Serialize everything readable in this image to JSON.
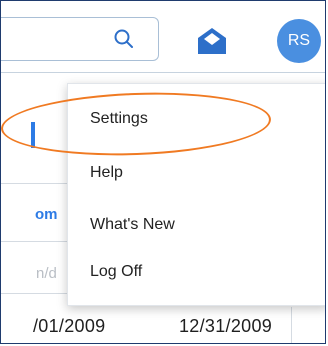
{
  "topbar": {
    "search_icon": "search-icon",
    "mail_icon": "envelope-open-icon",
    "avatar_initials": "RS",
    "accent_color": "#4a8fe0"
  },
  "menu": {
    "items": [
      {
        "label": "Settings"
      },
      {
        "label": "Help"
      },
      {
        "label": "What's New"
      },
      {
        "label": "Log Off"
      }
    ],
    "highlighted_item": "Settings",
    "highlight_color": "#f07a22"
  },
  "background": {
    "partial_text_1": "om",
    "partial_text_2": "n/d",
    "dates": [
      "/01/2009",
      "12/31/2009"
    ]
  }
}
